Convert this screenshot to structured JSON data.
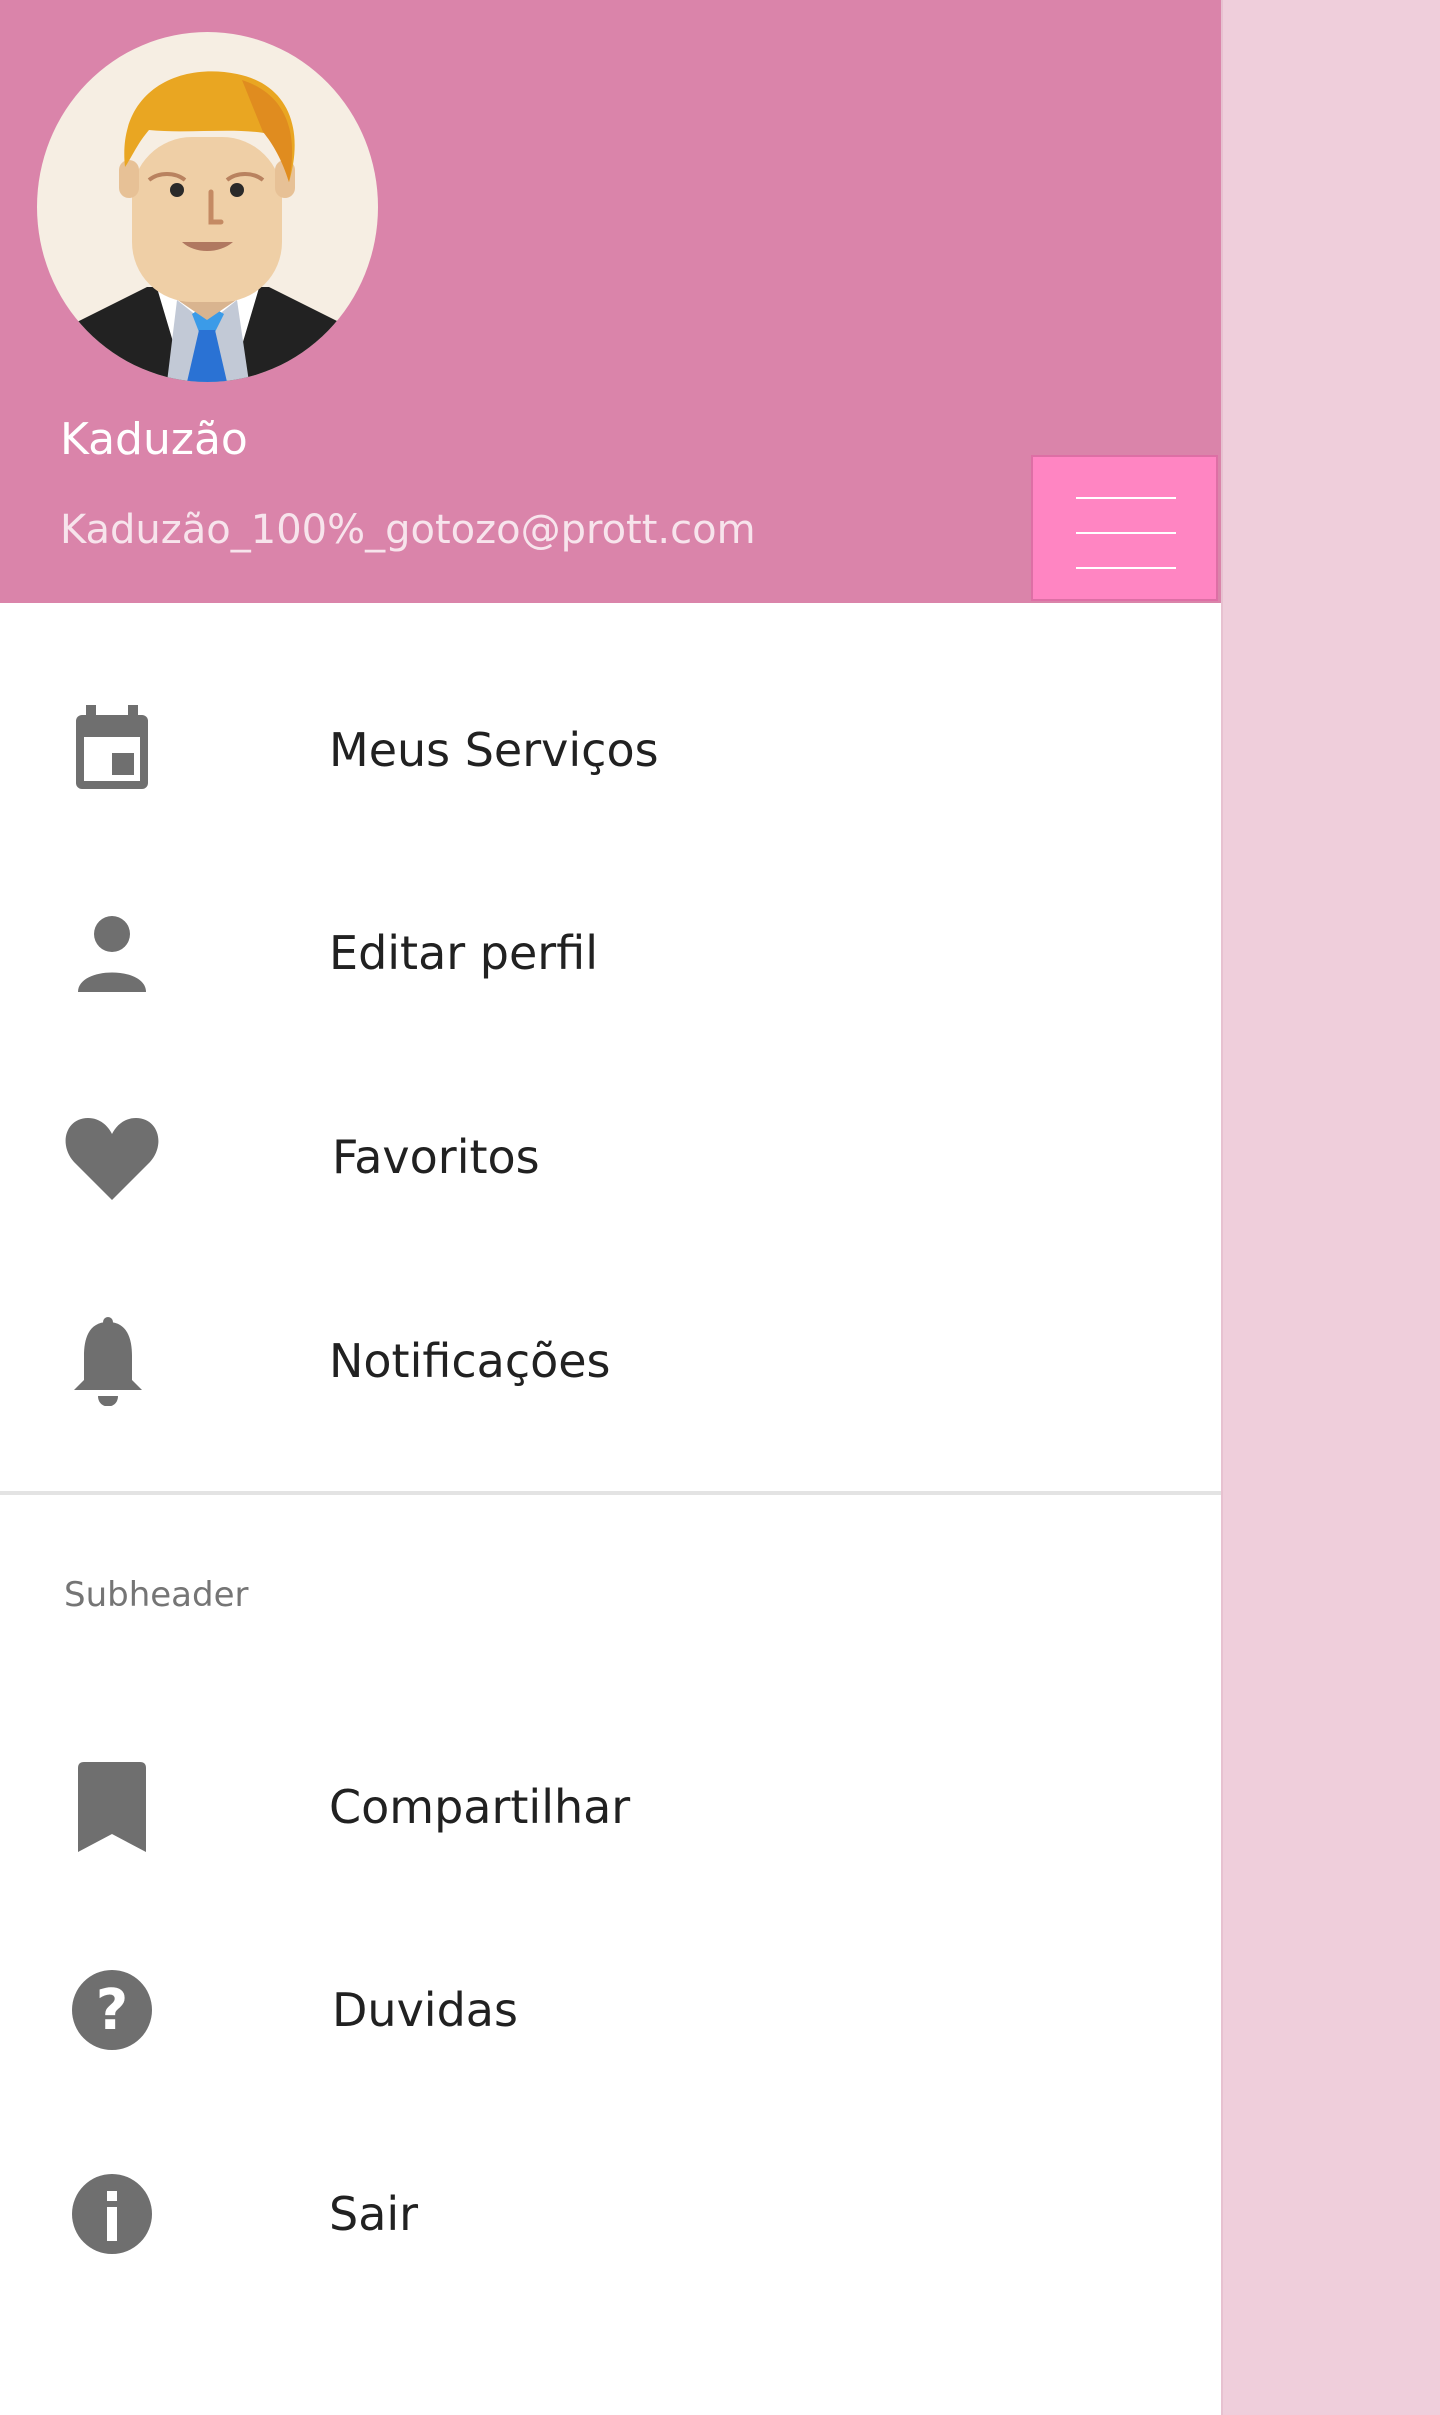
{
  "header": {
    "user_name": "Kaduzão",
    "user_email": "Kaduzão_100%_gotozo@prott.com",
    "background_color": "#da84aa",
    "menu_button_color": "#ff85c2"
  },
  "menu": {
    "items": [
      {
        "label": "Meus Serviços",
        "icon": "calendar-event-icon"
      },
      {
        "label": "Editar perfil",
        "icon": "person-icon"
      },
      {
        "label": "Favoritos",
        "icon": "heart-icon"
      },
      {
        "label": "Notificações",
        "icon": "bell-icon"
      }
    ]
  },
  "subheader": {
    "label": "Subheader",
    "items": [
      {
        "label": "Compartilhar",
        "icon": "bookmark-icon"
      },
      {
        "label": "Duvidas",
        "icon": "help-circle-icon"
      },
      {
        "label": "Sair",
        "icon": "info-circle-icon"
      }
    ]
  },
  "colors": {
    "icon": "#6f6f6f",
    "scrim": "#efcedb"
  }
}
